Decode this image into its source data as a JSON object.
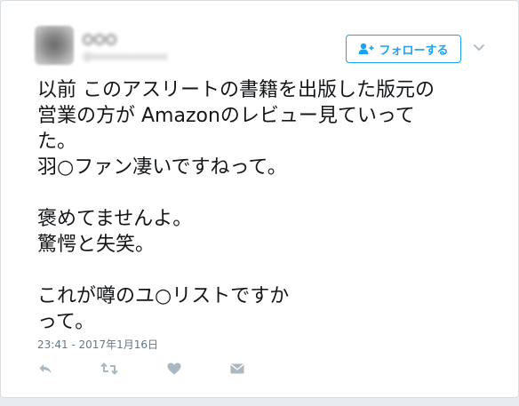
{
  "header": {
    "display_name": "〇〇〇",
    "handle": "@xxxxxxxxxxxxx"
  },
  "follow_button": {
    "label": "フォローする",
    "icon": "add-user-icon"
  },
  "menu": {
    "icon": "chevron-down-icon"
  },
  "tweet": {
    "text": "以前 このアスリートの書籍を出版した版元の\n営業の方が Amazonのレビュー見ていって\nた。\n羽○ファン凄いですねって。\n\n褒めてませんよ。\n驚愕と失笑。\n\nこれが噂のユ○リストですか\nって。",
    "timestamp": "23:41 - 2017年1月16日"
  },
  "actions": [
    {
      "name": "reply",
      "icon": "reply-icon"
    },
    {
      "name": "retweet",
      "icon": "retweet-icon"
    },
    {
      "name": "like",
      "icon": "heart-icon"
    },
    {
      "name": "direct-message",
      "icon": "envelope-icon"
    }
  ],
  "colors": {
    "accent": "#1da1f2",
    "text": "#14171a",
    "muted": "#657786",
    "icon": "#aab8c2",
    "background": "#e6ecf0"
  }
}
